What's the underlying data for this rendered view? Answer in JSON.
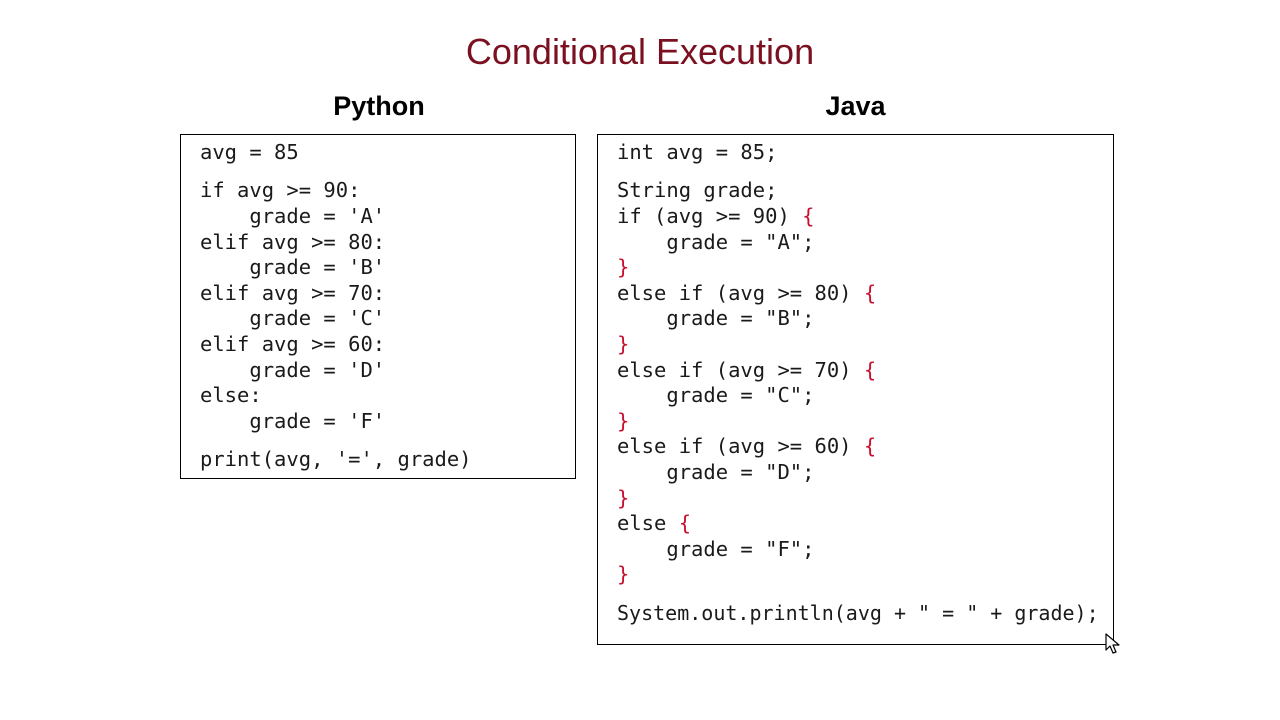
{
  "slide": {
    "title": "Conditional Execution"
  },
  "python": {
    "heading": "Python",
    "lines": [
      "avg = 85",
      "if avg >= 90:",
      "    grade = 'A'",
      "elif avg >= 80:",
      "    grade = 'B'",
      "elif avg >= 70:",
      "    grade = 'C'",
      "elif avg >= 60:",
      "    grade = 'D'",
      "else:",
      "    grade = 'F'",
      "print(avg, '=', grade)"
    ]
  },
  "java": {
    "heading": "Java",
    "lines": [
      "int avg = 85;",
      "String grade;",
      "if (avg >= 90) ",
      "    grade = \"A\";",
      "else if (avg >= 80) ",
      "    grade = \"B\";",
      "else if (avg >= 70) ",
      "    grade = \"C\";",
      "else if (avg >= 60) ",
      "    grade = \"D\";",
      "else ",
      "    grade = \"F\";",
      "System.out.println(avg + \" = \" + grade);"
    ],
    "open_brace": "{",
    "close_brace": "}"
  },
  "colors": {
    "title": "#7a1020",
    "brace": "#c8102e"
  },
  "icons": {
    "cursor": "mouse-pointer-icon"
  }
}
